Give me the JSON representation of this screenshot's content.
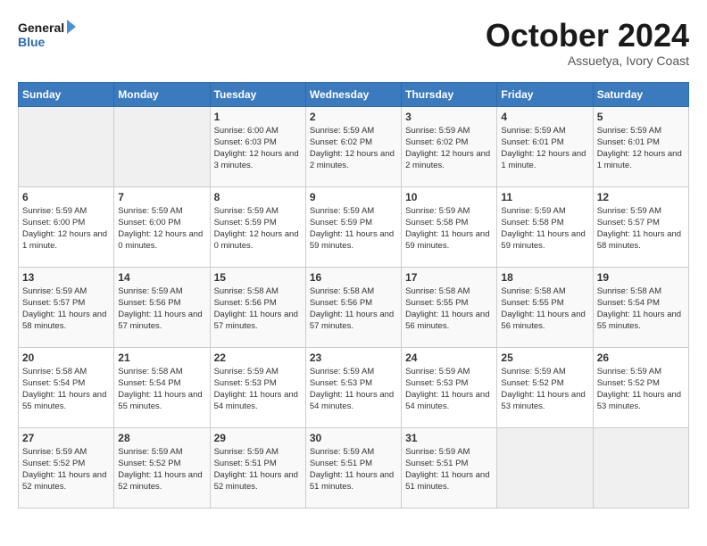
{
  "logo": {
    "line1": "General",
    "line2": "Blue"
  },
  "title": "October 2024",
  "location": "Assuetya, Ivory Coast",
  "weekdays": [
    "Sunday",
    "Monday",
    "Tuesday",
    "Wednesday",
    "Thursday",
    "Friday",
    "Saturday"
  ],
  "weeks": [
    [
      {
        "day": "",
        "info": ""
      },
      {
        "day": "",
        "info": ""
      },
      {
        "day": "1",
        "info": "Sunrise: 6:00 AM\nSunset: 6:03 PM\nDaylight: 12 hours and 3 minutes."
      },
      {
        "day": "2",
        "info": "Sunrise: 5:59 AM\nSunset: 6:02 PM\nDaylight: 12 hours and 2 minutes."
      },
      {
        "day": "3",
        "info": "Sunrise: 5:59 AM\nSunset: 6:02 PM\nDaylight: 12 hours and 2 minutes."
      },
      {
        "day": "4",
        "info": "Sunrise: 5:59 AM\nSunset: 6:01 PM\nDaylight: 12 hours and 1 minute."
      },
      {
        "day": "5",
        "info": "Sunrise: 5:59 AM\nSunset: 6:01 PM\nDaylight: 12 hours and 1 minute."
      }
    ],
    [
      {
        "day": "6",
        "info": "Sunrise: 5:59 AM\nSunset: 6:00 PM\nDaylight: 12 hours and 1 minute."
      },
      {
        "day": "7",
        "info": "Sunrise: 5:59 AM\nSunset: 6:00 PM\nDaylight: 12 hours and 0 minutes."
      },
      {
        "day": "8",
        "info": "Sunrise: 5:59 AM\nSunset: 5:59 PM\nDaylight: 12 hours and 0 minutes."
      },
      {
        "day": "9",
        "info": "Sunrise: 5:59 AM\nSunset: 5:59 PM\nDaylight: 11 hours and 59 minutes."
      },
      {
        "day": "10",
        "info": "Sunrise: 5:59 AM\nSunset: 5:58 PM\nDaylight: 11 hours and 59 minutes."
      },
      {
        "day": "11",
        "info": "Sunrise: 5:59 AM\nSunset: 5:58 PM\nDaylight: 11 hours and 59 minutes."
      },
      {
        "day": "12",
        "info": "Sunrise: 5:59 AM\nSunset: 5:57 PM\nDaylight: 11 hours and 58 minutes."
      }
    ],
    [
      {
        "day": "13",
        "info": "Sunrise: 5:59 AM\nSunset: 5:57 PM\nDaylight: 11 hours and 58 minutes."
      },
      {
        "day": "14",
        "info": "Sunrise: 5:59 AM\nSunset: 5:56 PM\nDaylight: 11 hours and 57 minutes."
      },
      {
        "day": "15",
        "info": "Sunrise: 5:58 AM\nSunset: 5:56 PM\nDaylight: 11 hours and 57 minutes."
      },
      {
        "day": "16",
        "info": "Sunrise: 5:58 AM\nSunset: 5:56 PM\nDaylight: 11 hours and 57 minutes."
      },
      {
        "day": "17",
        "info": "Sunrise: 5:58 AM\nSunset: 5:55 PM\nDaylight: 11 hours and 56 minutes."
      },
      {
        "day": "18",
        "info": "Sunrise: 5:58 AM\nSunset: 5:55 PM\nDaylight: 11 hours and 56 minutes."
      },
      {
        "day": "19",
        "info": "Sunrise: 5:58 AM\nSunset: 5:54 PM\nDaylight: 11 hours and 55 minutes."
      }
    ],
    [
      {
        "day": "20",
        "info": "Sunrise: 5:58 AM\nSunset: 5:54 PM\nDaylight: 11 hours and 55 minutes."
      },
      {
        "day": "21",
        "info": "Sunrise: 5:58 AM\nSunset: 5:54 PM\nDaylight: 11 hours and 55 minutes."
      },
      {
        "day": "22",
        "info": "Sunrise: 5:59 AM\nSunset: 5:53 PM\nDaylight: 11 hours and 54 minutes."
      },
      {
        "day": "23",
        "info": "Sunrise: 5:59 AM\nSunset: 5:53 PM\nDaylight: 11 hours and 54 minutes."
      },
      {
        "day": "24",
        "info": "Sunrise: 5:59 AM\nSunset: 5:53 PM\nDaylight: 11 hours and 54 minutes."
      },
      {
        "day": "25",
        "info": "Sunrise: 5:59 AM\nSunset: 5:52 PM\nDaylight: 11 hours and 53 minutes."
      },
      {
        "day": "26",
        "info": "Sunrise: 5:59 AM\nSunset: 5:52 PM\nDaylight: 11 hours and 53 minutes."
      }
    ],
    [
      {
        "day": "27",
        "info": "Sunrise: 5:59 AM\nSunset: 5:52 PM\nDaylight: 11 hours and 52 minutes."
      },
      {
        "day": "28",
        "info": "Sunrise: 5:59 AM\nSunset: 5:52 PM\nDaylight: 11 hours and 52 minutes."
      },
      {
        "day": "29",
        "info": "Sunrise: 5:59 AM\nSunset: 5:51 PM\nDaylight: 11 hours and 52 minutes."
      },
      {
        "day": "30",
        "info": "Sunrise: 5:59 AM\nSunset: 5:51 PM\nDaylight: 11 hours and 51 minutes."
      },
      {
        "day": "31",
        "info": "Sunrise: 5:59 AM\nSunset: 5:51 PM\nDaylight: 11 hours and 51 minutes."
      },
      {
        "day": "",
        "info": ""
      },
      {
        "day": "",
        "info": ""
      }
    ]
  ]
}
